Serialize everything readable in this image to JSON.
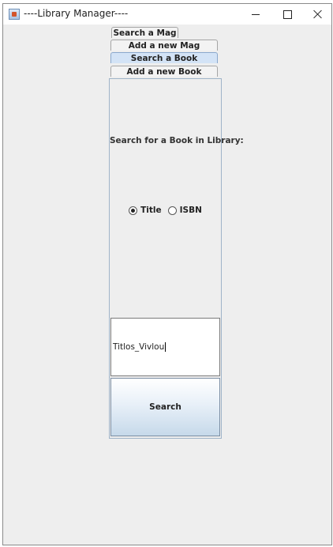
{
  "window": {
    "title": "----Library Manager----",
    "icon": "java-cup-icon"
  },
  "tabs": [
    {
      "label": "Search a Mag"
    },
    {
      "label": "Add a new Mag"
    },
    {
      "label": "Search a Book",
      "selected": true
    },
    {
      "label": "Add a new Book"
    }
  ],
  "search_panel": {
    "heading": "Search for a Book in Library:",
    "radio_options": [
      {
        "label": "Title",
        "checked": true
      },
      {
        "label": "ISBN",
        "checked": false
      }
    ],
    "input_value": "Titlos_Vivlou",
    "search_label": "Search"
  },
  "colors": {
    "selected_tab": "#d3e3f6",
    "window_background": "#eeeeee"
  }
}
